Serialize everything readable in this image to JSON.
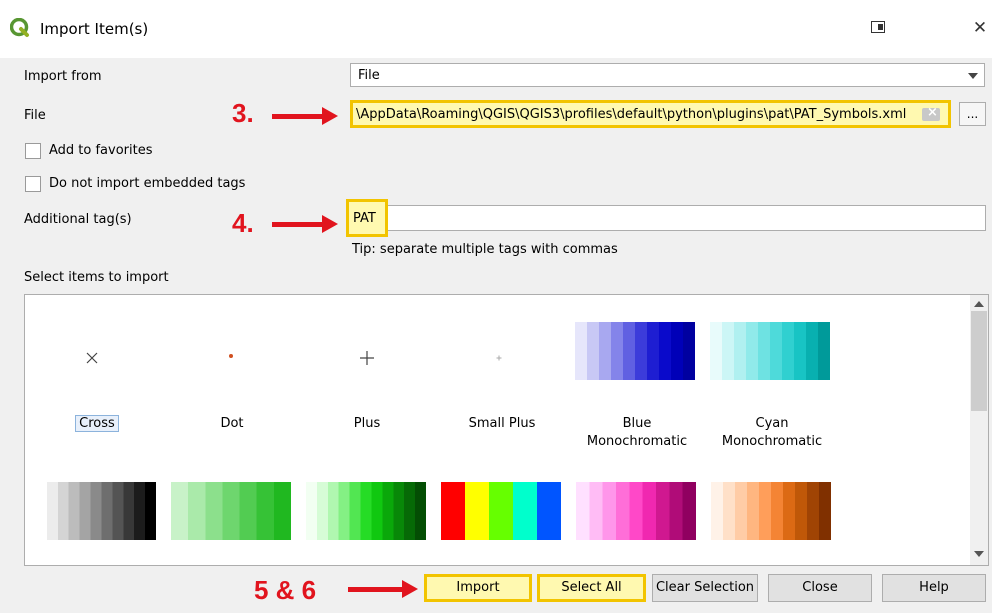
{
  "window": {
    "title": "Import Item(s)"
  },
  "form": {
    "import_from_label": "Import from",
    "import_from_value": "File",
    "file_label": "File",
    "file_value": "\\AppData\\Roaming\\QGIS\\QGIS3\\profiles\\default\\python\\plugins\\pat\\PAT_Symbols.xml",
    "browse_label": "...",
    "add_favorites_label": "Add to favorites",
    "no_embedded_tags_label": "Do not import embedded tags",
    "additional_tags_label": "Additional tag(s)",
    "additional_tags_value": "PAT",
    "tip": "Tip: separate multiple tags with commas",
    "select_items_label": "Select items to import"
  },
  "annotations": {
    "step3": "3.",
    "step4": "4.",
    "step56": "5 & 6"
  },
  "items_row1": [
    {
      "label": "Cross",
      "icon": "cross-marker-icon"
    },
    {
      "label": "Dot",
      "icon": "dot-marker-icon"
    },
    {
      "label": "Plus",
      "icon": "plus-marker-icon"
    },
    {
      "label": "Small Plus",
      "icon": "small-plus-marker-icon"
    },
    {
      "label": "Blue\nMonochromatic",
      "icon": "blue-ramp"
    },
    {
      "label": "Cyan\nMonochromatic",
      "icon": "cyan-ramp"
    }
  ],
  "ramp_colors": {
    "blue": [
      "#e6e6fb",
      "#c8c8f5",
      "#a8a8f0",
      "#8484ea",
      "#6060e2",
      "#3c3cda",
      "#1e1ed2",
      "#0a0acb",
      "#0000b8",
      "#0000a0"
    ],
    "cyan": [
      "#e8fbfb",
      "#ccf6f6",
      "#b0f0f0",
      "#90eaea",
      "#6ee2e2",
      "#4edada",
      "#30d0d0",
      "#18c4c4",
      "#08b0b0",
      "#009a9a"
    ],
    "gray": [
      "#ffffff",
      "#ececec",
      "#d4d4d4",
      "#bcbcbc",
      "#a4a4a4",
      "#8a8a8a",
      "#6e6e6e",
      "#545454",
      "#383838",
      "#1c1c1c",
      "#000000"
    ],
    "green": [
      "#c8f2c8",
      "#aaeaaa",
      "#8ce08c",
      "#6ed66e",
      "#52cc52",
      "#36c236",
      "#20b820"
    ],
    "green2": [
      "#f2fff2",
      "#d6fcd6",
      "#b0f7b0",
      "#84f084",
      "#52e652",
      "#26dc26",
      "#10c810",
      "#0aa80a",
      "#088808",
      "#066a06",
      "#044e04"
    ],
    "rainbow": [
      "#ff0000",
      "#ffff00",
      "#66ff00",
      "#00ffcc",
      "#0055ff"
    ],
    "magenta": [
      "#ffe0ff",
      "#ffbcf5",
      "#ff96ea",
      "#ff6ed8",
      "#ff48c8",
      "#f028b0",
      "#d01890",
      "#b00c78",
      "#900060"
    ],
    "orange": [
      "#fff2e8",
      "#ffe0c8",
      "#ffcca6",
      "#ffb680",
      "#ff9e5a",
      "#f48434",
      "#dc6a14",
      "#c05808",
      "#a04404",
      "#803000"
    ]
  },
  "buttons": {
    "import": "Import",
    "select_all": "Select All",
    "clear_selection": "Clear Selection",
    "close": "Close",
    "help": "Help"
  }
}
